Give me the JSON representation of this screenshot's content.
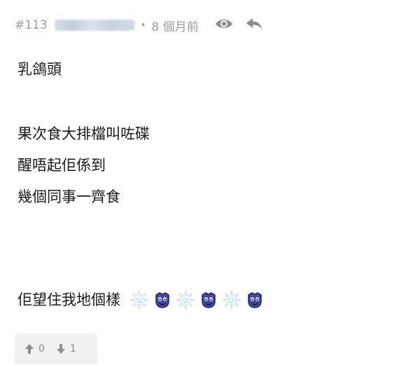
{
  "post": {
    "number": "#113",
    "time_ago": "8 個月前",
    "lines": [
      "乳鴿頭",
      "果次食大排檔叫咗碟",
      "醒唔起佢係到",
      "幾個同事一齊食",
      "佢望住我地個樣"
    ],
    "emojis": [
      "sun-face",
      "blue-devil-face",
      "sun-face",
      "blue-devil-face",
      "sun-face",
      "blue-devil-face"
    ]
  },
  "votes": {
    "up": "0",
    "down": "1"
  },
  "colors": {
    "meta": "#9e9e9e",
    "text": "#1a1a1a",
    "vote_bg": "#f1f1f1"
  }
}
